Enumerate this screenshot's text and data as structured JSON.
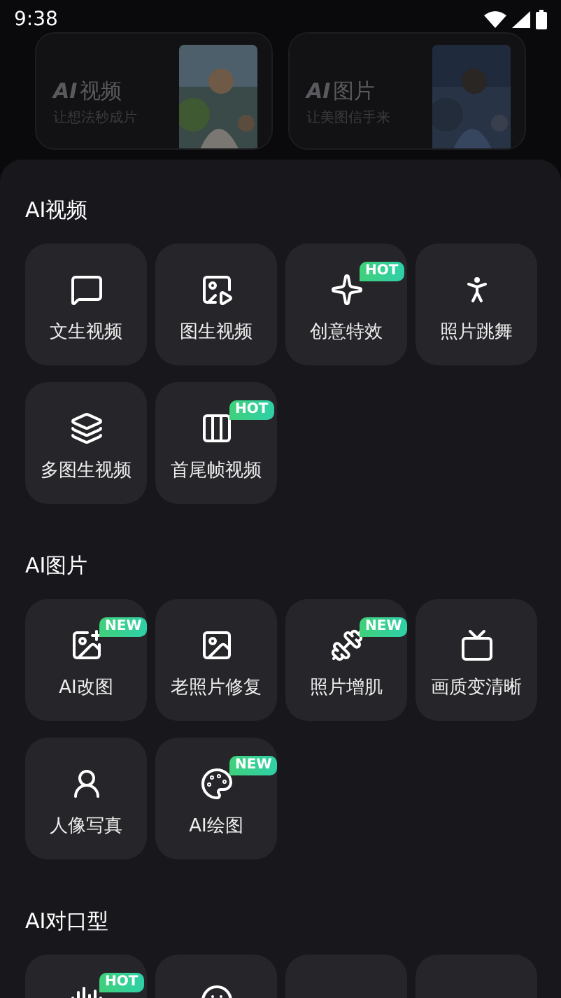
{
  "status_bar": {
    "time": "9:38"
  },
  "banners": [
    {
      "logo": "AI",
      "title": "视频",
      "subtitle": "让想法秒成片"
    },
    {
      "logo": "AI",
      "title": "图片",
      "subtitle": "让美图信手来"
    }
  ],
  "sections": [
    {
      "title": "AI视频",
      "items": [
        {
          "kind": "tile",
          "label": "文生视频"
        },
        {
          "kind": "tile",
          "label": "图生视频"
        },
        {
          "kind": "tile",
          "label": "创意特效",
          "badge": "HOT"
        },
        {
          "kind": "tile",
          "label": "照片跳舞"
        },
        {
          "kind": "tile",
          "label": "多图生视频"
        },
        {
          "kind": "tile",
          "label": "首尾帧视频",
          "badge": "HOT"
        }
      ]
    },
    {
      "title": "AI图片",
      "items": [
        {
          "kind": "tile",
          "label": "AI改图",
          "badge": "NEW"
        },
        {
          "kind": "tile",
          "label": "老照片修复"
        },
        {
          "kind": "tile",
          "label": "照片增肌",
          "badge": "NEW"
        },
        {
          "kind": "tile",
          "label": "画质变清晰"
        },
        {
          "kind": "tile",
          "label": "人像写真"
        },
        {
          "kind": "tile",
          "label": "AI绘图",
          "badge": "NEW"
        }
      ]
    },
    {
      "title": "AI对口型",
      "items": [
        {
          "kind": "tile",
          "badge": "HOT"
        },
        {
          "kind": "tile"
        },
        {
          "kind": "tile"
        },
        {
          "kind": "tile"
        }
      ]
    }
  ]
}
